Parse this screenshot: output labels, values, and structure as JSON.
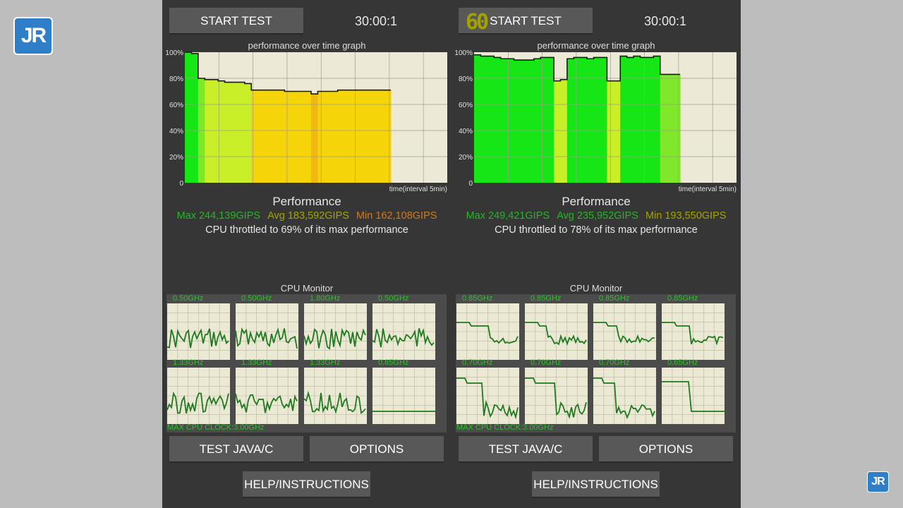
{
  "logo": {
    "text": "JR"
  },
  "panes": [
    {
      "start_label": "START TEST",
      "timer": "30:00:1",
      "fps": "",
      "graph_title": "performance over time graph",
      "y_ticks": [
        "100%",
        "80%",
        "60%",
        "40%",
        "20%",
        "0"
      ],
      "x_label": "time(interval 5min)",
      "perf_title": "Performance",
      "max": "Max 244,139GIPS",
      "avg": "Avg 183,592GIPS",
      "min": "Min 162,108GIPS",
      "max_color": "#22b822",
      "avg_color": "#a3a300",
      "min_color": "#d07a1a",
      "throttle": "CPU throttled to 69% of its max performance",
      "monitor_title": "CPU Monitor",
      "cores": [
        {
          "label": "0.50GHz"
        },
        {
          "label": "0.50GHz"
        },
        {
          "label": "1.80GHz"
        },
        {
          "label": "0.50GHz"
        },
        {
          "label": "1.33GHz"
        },
        {
          "label": "1.33GHz"
        },
        {
          "label": "1.33GHz"
        },
        {
          "label": "0.65GHz"
        }
      ],
      "max_clock": "MAX CPU CLOCK:3.00GHz",
      "java_label": "TEST JAVA/C",
      "options_label": "OPTIONS",
      "help_label": "HELP/INSTRUCTIONS",
      "chart_data": {
        "type": "area",
        "title": "performance over time graph",
        "xlabel": "time(interval 5min)",
        "ylabel": "",
        "ylim": [
          0,
          100
        ],
        "x": [
          0,
          1,
          2,
          3,
          4,
          5,
          6,
          7,
          8,
          9,
          10,
          11,
          12,
          13,
          14,
          15,
          16,
          17,
          18,
          19,
          20,
          21,
          22,
          23,
          24,
          25,
          26,
          27,
          28,
          29,
          30
        ],
        "values": [
          100,
          99,
          80,
          79,
          79,
          78,
          77,
          77,
          77,
          76,
          71,
          71,
          71,
          71,
          71,
          70,
          70,
          70,
          70,
          68,
          70,
          70,
          70,
          71,
          71,
          71,
          71,
          71,
          71,
          71,
          71
        ]
      }
    },
    {
      "start_label": "START TEST",
      "timer": "30:00:1",
      "fps": "60",
      "graph_title": "performance over time graph",
      "y_ticks": [
        "100%",
        "80%",
        "60%",
        "40%",
        "20%",
        "0"
      ],
      "x_label": "time(interval 5min)",
      "perf_title": "Performance",
      "max": "Max 249,421GIPS",
      "avg": "Avg 235,952GIPS",
      "min": "Min 193,550GIPS",
      "max_color": "#22b822",
      "avg_color": "#22b822",
      "min_color": "#a3a300",
      "throttle": "CPU throttled to 78% of its max performance",
      "monitor_title": "CPU Monitor",
      "cores": [
        {
          "label": "0.85GHz"
        },
        {
          "label": "0.85GHz"
        },
        {
          "label": "0.85GHz"
        },
        {
          "label": "0.85GHz"
        },
        {
          "label": "0.70GHz"
        },
        {
          "label": "0.70GHz"
        },
        {
          "label": "0.70GHz"
        },
        {
          "label": "0.65GHz"
        }
      ],
      "max_clock": "MAX CPU CLOCK:3.00GHz",
      "java_label": "TEST JAVA/C",
      "options_label": "OPTIONS",
      "help_label": "HELP/INSTRUCTIONS",
      "chart_data": {
        "type": "area",
        "title": "performance over time graph",
        "xlabel": "time(interval 5min)",
        "ylabel": "",
        "ylim": [
          0,
          100
        ],
        "x": [
          0,
          1,
          2,
          3,
          4,
          5,
          6,
          7,
          8,
          9,
          10,
          11,
          12,
          13,
          14,
          15,
          16,
          17,
          18,
          19,
          20,
          21,
          22,
          23,
          24,
          25,
          26,
          27,
          28,
          29,
          30
        ],
        "values": [
          98,
          97,
          97,
          96,
          95,
          95,
          94,
          94,
          94,
          95,
          96,
          96,
          78,
          79,
          95,
          96,
          96,
          95,
          96,
          96,
          78,
          78,
          97,
          96,
          97,
          96,
          96,
          97,
          83,
          83,
          83
        ]
      }
    }
  ]
}
